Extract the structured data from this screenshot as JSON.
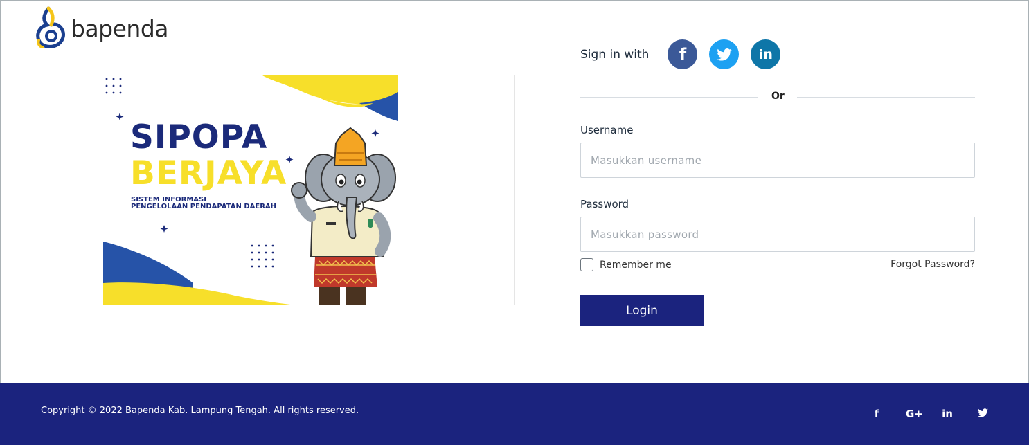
{
  "brand": {
    "name": "bapenda"
  },
  "illustration": {
    "title_line1": "SIPOPA",
    "title_line2": "BERJAYA",
    "subtitle_line1": "SISTEM INFORMASI",
    "subtitle_line2": "PENGELOLAAN PENDAPATAN DAERAH"
  },
  "login": {
    "sign_in_with": "Sign in with",
    "social": [
      {
        "icon": "facebook-icon",
        "glyph": "f"
      },
      {
        "icon": "twitter-icon",
        "glyph": "🐦"
      },
      {
        "icon": "linkedin-icon",
        "glyph": "in"
      }
    ],
    "or_label": "Or",
    "username_label": "Username",
    "username_placeholder": "Masukkan username",
    "username_value": "",
    "password_label": "Password",
    "password_placeholder": "Masukkan password",
    "password_value": "",
    "remember_label": "Remember me",
    "forgot_label": "Forgot Password?",
    "login_label": "Login"
  },
  "footer": {
    "copyright": "Copyright © 2022 Bapenda Kab. Lampung Tengah. All rights reserved.",
    "icons": [
      {
        "icon": "facebook-icon",
        "glyph": "f"
      },
      {
        "icon": "google-plus-icon",
        "glyph": "G+"
      },
      {
        "icon": "linkedin-icon",
        "glyph": "in"
      },
      {
        "icon": "twitter-icon",
        "glyph": "🐦"
      }
    ]
  },
  "colors": {
    "primary": "#1b237e",
    "brand_yellow": "#f7df2a",
    "brand_blue": "#1b2a7a",
    "facebook": "#3b5998",
    "twitter": "#1da1f2",
    "linkedin": "#0e76a8"
  }
}
